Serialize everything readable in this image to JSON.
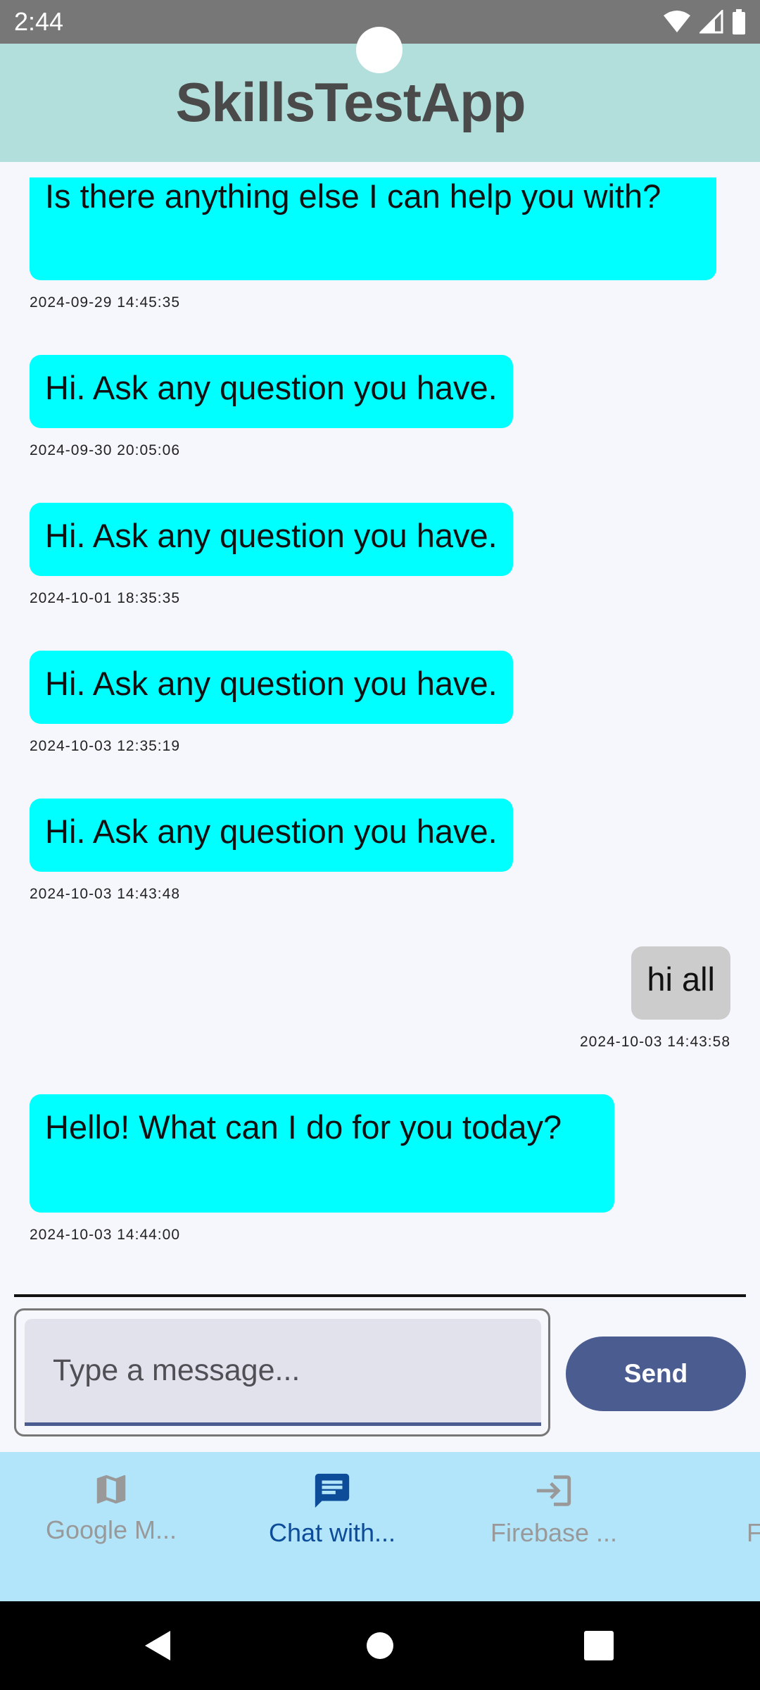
{
  "status_bar": {
    "time": "2:44"
  },
  "app_bar": {
    "title": "SkillsTestApp"
  },
  "messages": [
    {
      "sender": "bot",
      "text": "Is there anything else I can help you with?",
      "timestamp": "2024-09-29 14:45:35"
    },
    {
      "sender": "bot",
      "text": "Hi. Ask any question you have.",
      "timestamp": "2024-09-30 20:05:06"
    },
    {
      "sender": "bot",
      "text": "Hi. Ask any question you have.",
      "timestamp": "2024-10-01 18:35:35"
    },
    {
      "sender": "bot",
      "text": "Hi. Ask any question you have.",
      "timestamp": "2024-10-03 12:35:19"
    },
    {
      "sender": "bot",
      "text": "Hi. Ask any question you have.",
      "timestamp": "2024-10-03 14:43:48"
    },
    {
      "sender": "user",
      "text": "hi all",
      "timestamp": "2024-10-03 14:43:58"
    },
    {
      "sender": "bot",
      "text": "Hello! What can I do for you today?",
      "timestamp": "2024-10-03 14:44:00"
    }
  ],
  "composer": {
    "placeholder": "Type a message...",
    "value": "",
    "send_label": "Send"
  },
  "bottom_nav": {
    "items": [
      {
        "label": "Google M...",
        "icon": "map-icon",
        "active": false
      },
      {
        "label": "Chat with...",
        "icon": "chat-icon",
        "active": true
      },
      {
        "label": "Firebase ...",
        "icon": "login-icon",
        "active": false
      },
      {
        "label": "Four",
        "icon": "more-icon",
        "active": false
      }
    ]
  },
  "colors": {
    "app_bar": "#b2dfdb",
    "bot_bubble": "#00ffff",
    "user_bubble": "#cccccc",
    "accent": "#4b5c91",
    "nav_bg": "#b3e5fa",
    "nav_active": "#0d4c99"
  }
}
